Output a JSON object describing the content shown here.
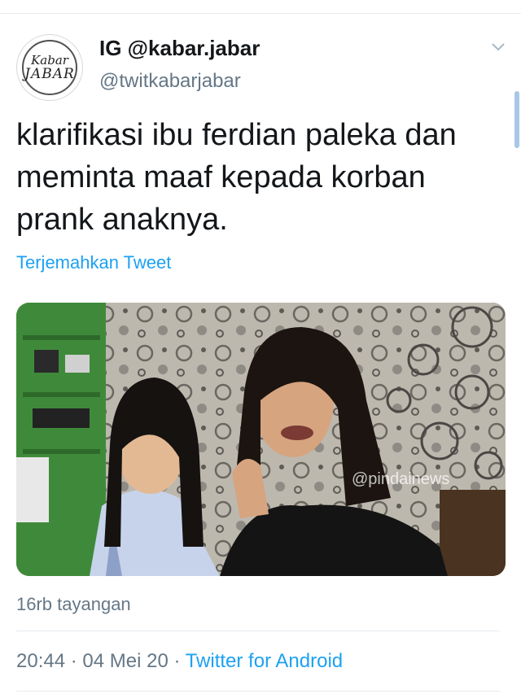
{
  "tweet": {
    "avatar": {
      "logo_line1": "Kabar",
      "logo_line2": "JABAR"
    },
    "display_name": "IG @kabar.jabar",
    "handle": "@twitkabarjabar",
    "text": "klarifikasi ibu ferdian paleka dan meminta maaf kepada korban prank anaknya.",
    "translate_label": "Terjemahkan Tweet",
    "media": {
      "watermark": "@pindainews"
    },
    "views": "16rb tayangan",
    "time": "20:44",
    "separator": " · ",
    "date": "04 Mei 20",
    "source": "Twitter for Android"
  },
  "icons": {
    "menu": "chevron-down-icon"
  },
  "colors": {
    "link": "#1da1f2",
    "secondary": "#657786",
    "text": "#14171a"
  }
}
